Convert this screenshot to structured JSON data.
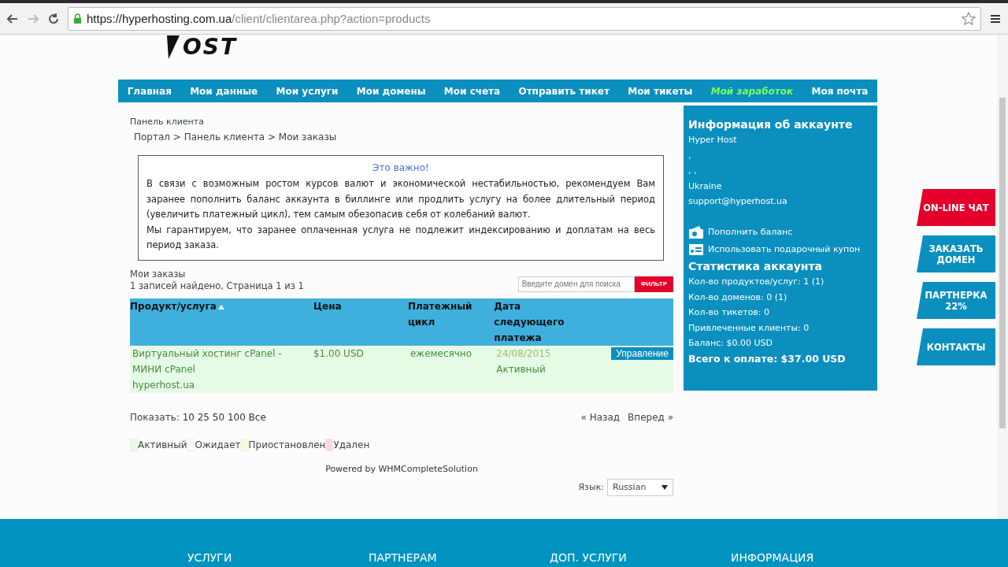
{
  "browser": {
    "url_host": "https://hyperhosting.com.ua",
    "url_path": "/client/clientarea.php?action=products"
  },
  "logo": {
    "text": "OST"
  },
  "nav": [
    {
      "label": "Главная",
      "highlighted": false
    },
    {
      "label": "Мои данные",
      "highlighted": false
    },
    {
      "label": "Мои услуги",
      "highlighted": false
    },
    {
      "label": "Мои домены",
      "highlighted": false
    },
    {
      "label": "Мои счета",
      "highlighted": false
    },
    {
      "label": "Отправить тикет",
      "highlighted": false
    },
    {
      "label": "Мои тикеты",
      "highlighted": false
    },
    {
      "label": "Мой заработок",
      "highlighted": true
    },
    {
      "label": "Моя почта",
      "highlighted": false
    }
  ],
  "page_title": "Панель клиента",
  "breadcrumb": "Портал > Панель клиента > Мои заказы",
  "notice": {
    "title": "Это важно!",
    "paragraphs": [
      "В связи с возможным ростом курсов валют и экономической нестабильностью, рекомендуем Вам заранее пополнить баланс аккаунта в биллинге или продлить услугу на более длительный период (увеличить платежный цикл), тем самым обезопасив себя от колебаний валют.",
      "Мы гарантируем, что заранее оплаченная услуга не подлежит индексированию и доплатам на весь период заказа."
    ]
  },
  "orders": {
    "title": "Мои заказы",
    "summary": "1 записей найдено, Страница 1 из 1",
    "search": {
      "placeholder": "Введите домен для поиска"
    },
    "filter_button": "ФИЛЬТР",
    "columns": [
      "Продукт/услуга",
      "Цена",
      "Платежный цикл",
      "Дата следующего платежа"
    ],
    "rows": [
      {
        "product": "Виртуальный хостинг cPanel - МИНИ cPanel",
        "domain": "hyperhost.ua",
        "price": "$1.00 USD",
        "cycle": "ежемесячно",
        "date": "24/08/2015",
        "status": "Активный",
        "action": "Управление"
      }
    ],
    "show_label": "Показать:",
    "show_options": "10 25 50 100 Все",
    "prev": "« Назад",
    "next": "Вперед »",
    "legend": [
      {
        "label": "Активный",
        "color": "#e6fbe6"
      },
      {
        "label": "Ожидает",
        "color": "#ffffff"
      },
      {
        "label": "Приостановлен",
        "color": "#fdf8d8"
      },
      {
        "label": "Удален",
        "color": "#fbd9dd"
      }
    ]
  },
  "powered": "Powered by WHMCompleteSolution",
  "language": {
    "label": "Язык:",
    "value": "Russian"
  },
  "account": {
    "title": "Информация об аккаунте",
    "lines": [
      "Hyper Host",
      ",",
      ", ,",
      "Ukraine",
      "support@hyperhost.ua"
    ],
    "actions": [
      {
        "kind": "wallet",
        "label": "Пополнить баланс"
      },
      {
        "kind": "coupon",
        "label": "Использовать подарочный купон"
      }
    ],
    "stats_title": "Статистика аккаунта",
    "stats": [
      "Кол-во продуктов/услуг: 1 (1)",
      "Кол-во доменов: 0 (1)",
      "Кол-во тикетов: 0",
      "Привлеченные клиенты: 0",
      "Баланс: $0.00 USD"
    ],
    "total": "Всего к оплате: $37.00 USD"
  },
  "side_tabs": [
    {
      "label": "ON-LINE ЧАТ",
      "color": "#e4002b"
    },
    {
      "label": "ЗАКАЗАТЬ ДОМЕН",
      "color": "#0b8fbf"
    },
    {
      "label": "ПАРТНЕРКА 22%",
      "color": "#0b8fbf"
    },
    {
      "label": "КОНТАКТЫ",
      "color": "#0b8fbf"
    }
  ],
  "footer": [
    "УСЛУГИ",
    "ПАРТНЕРАМ",
    "ДОП. УСЛУГИ",
    "ИНФОРМАЦИЯ"
  ]
}
